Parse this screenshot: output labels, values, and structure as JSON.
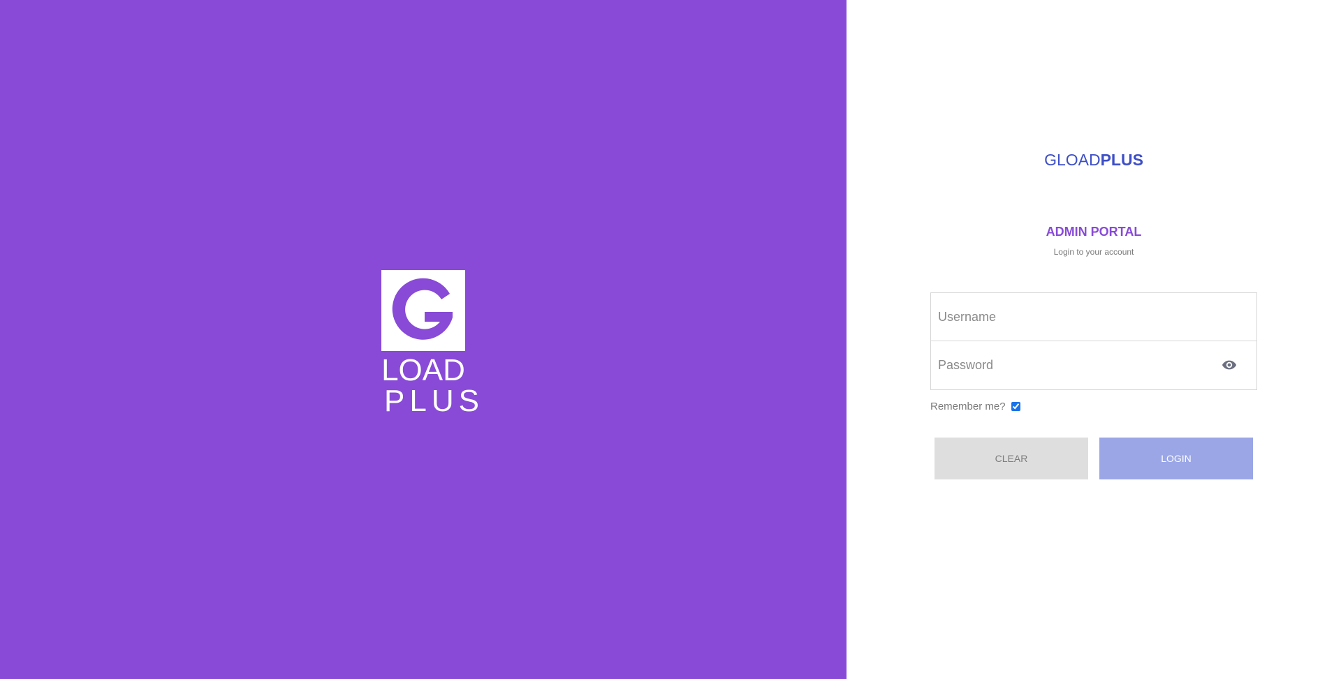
{
  "brand": {
    "colors": {
      "primary_purple": "#884ad7",
      "logo_blue": "#3d4fc7",
      "login_button": "#9aa6e6",
      "clear_button": "#dedede"
    },
    "mark": {
      "letter": "G",
      "line1": "LOAD",
      "line2": "PLUS"
    }
  },
  "login": {
    "logo_thin": "GLOAD",
    "logo_bold": "PLUS",
    "title": "ADMIN PORTAL",
    "subtitle": "Login to your account",
    "username_placeholder": "Username",
    "password_placeholder": "Password",
    "password_toggle_icon": "eye-icon",
    "remember_label": "Remember me?",
    "remember_checked": true,
    "clear_label": "CLEAR",
    "login_label": "LOGIN"
  }
}
